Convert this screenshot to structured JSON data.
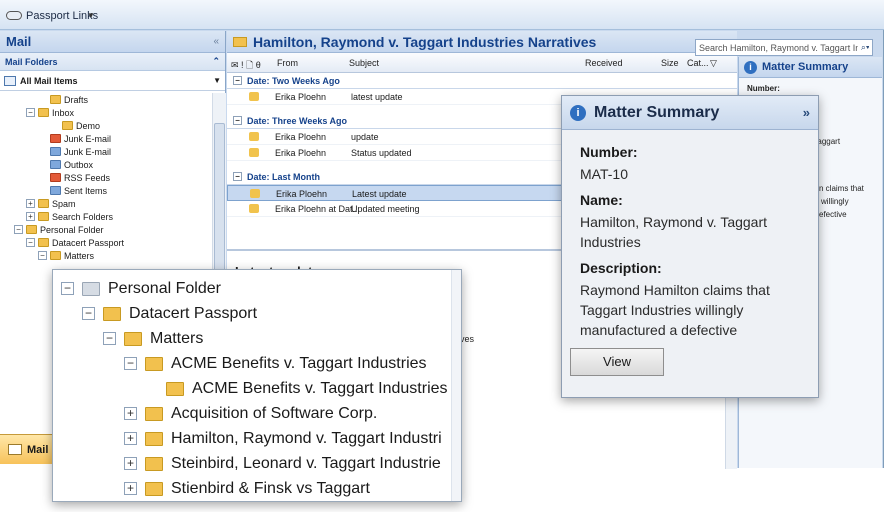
{
  "toolbar": {
    "passport_links": "Passport Links"
  },
  "nav": {
    "title": "Mail",
    "folders_header": "Mail Folders",
    "all_mail": "All Mail Items",
    "items": [
      {
        "label": "Drafts",
        "level": 2,
        "exp": ""
      },
      {
        "label": "Inbox",
        "level": 1,
        "exp": "⊟"
      },
      {
        "label": "Demo",
        "level": 3,
        "exp": ""
      },
      {
        "label": "Junk E-mail",
        "level": 2,
        "exp": ""
      },
      {
        "label": "Junk E-mail",
        "level": 2,
        "exp": ""
      },
      {
        "label": "Outbox",
        "level": 2,
        "exp": ""
      },
      {
        "label": "RSS Feeds",
        "level": 2,
        "exp": ""
      },
      {
        "label": "Sent Items",
        "level": 2,
        "exp": ""
      },
      {
        "label": "Spam",
        "level": 1,
        "exp": "⊞"
      },
      {
        "label": "Search Folders",
        "level": 1,
        "exp": "⊞"
      },
      {
        "label": "Personal Folder",
        "level": 0,
        "exp": "⊟"
      },
      {
        "label": "Datacert Passport",
        "level": 1,
        "exp": "⊟"
      },
      {
        "label": "Matters",
        "level": 2,
        "exp": "⊟"
      }
    ],
    "mail_button": "Mail"
  },
  "main": {
    "title": "Hamilton, Raymond v. Taggart Industries Narratives",
    "search_placeholder": "Search Hamilton, Raymond v. Taggart Indu",
    "columns": {
      "from": "From",
      "subject": "Subject",
      "received": "Received",
      "size": "Size",
      "cat": "Cat..."
    },
    "groups": [
      {
        "label": "Date: Two Weeks Ago",
        "rows": [
          {
            "from": "Erika Ploehn",
            "subject": "latest update",
            "selected": false
          }
        ]
      },
      {
        "label": "Date: Three Weeks Ago",
        "rows": [
          {
            "from": "Erika Ploehn",
            "subject": "update",
            "selected": false
          },
          {
            "from": "Erika Ploehn",
            "subject": "Status updated",
            "selected": false
          }
        ]
      },
      {
        "label": "Date: Last Month",
        "rows": [
          {
            "from": "Erika Ploehn",
            "subject": "Latest update",
            "selected": true
          },
          {
            "from": "Erika Ploehn at Dat...",
            "subject": "Updated meeting",
            "selected": false
          }
        ]
      }
    ],
    "reading_title": "Latest update",
    "reading_fragment": "ives"
  },
  "right": {
    "title": "Matter Summary",
    "fragments": [
      "Number:",
      "d v. Taggart",
      "n claims that",
      "willingly",
      "efective"
    ]
  },
  "callout_tree": [
    {
      "label": "Personal Folder",
      "level": 0,
      "exp": "⊟",
      "icon": "personal"
    },
    {
      "label": "Datacert Passport",
      "level": 1,
      "exp": "⊟",
      "icon": "folder"
    },
    {
      "label": "Matters",
      "level": 2,
      "exp": "⊟",
      "icon": "folder"
    },
    {
      "label": "ACME Benefits v. Taggart Industries",
      "level": 3,
      "exp": "⊟",
      "icon": "folder"
    },
    {
      "label": "ACME Benefits v. Taggart Industries",
      "level": 4,
      "exp": "",
      "icon": "folder"
    },
    {
      "label": "Acquisition of Software Corp.",
      "level": 3,
      "exp": "⊞",
      "icon": "folder"
    },
    {
      "label": "Hamilton, Raymond v. Taggart Industri",
      "level": 3,
      "exp": "⊞",
      "icon": "folder"
    },
    {
      "label": "Steinbird, Leonard v. Taggart Industrie",
      "level": 3,
      "exp": "⊞",
      "icon": "folder"
    },
    {
      "label": "Stienbird & Finsk vs Taggart",
      "level": 3,
      "exp": "⊞",
      "icon": "folder"
    }
  ],
  "popup": {
    "title": "Matter Summary",
    "close": "»",
    "number_label": "Number:",
    "number_value": "MAT-10",
    "name_label": "Name:",
    "name_value": "Hamilton, Raymond v. Taggart Industries",
    "desc_label": "Description:",
    "desc_value": "Raymond Hamilton claims that Taggart Industries willingly manufactured a defective",
    "view_button": "View"
  }
}
